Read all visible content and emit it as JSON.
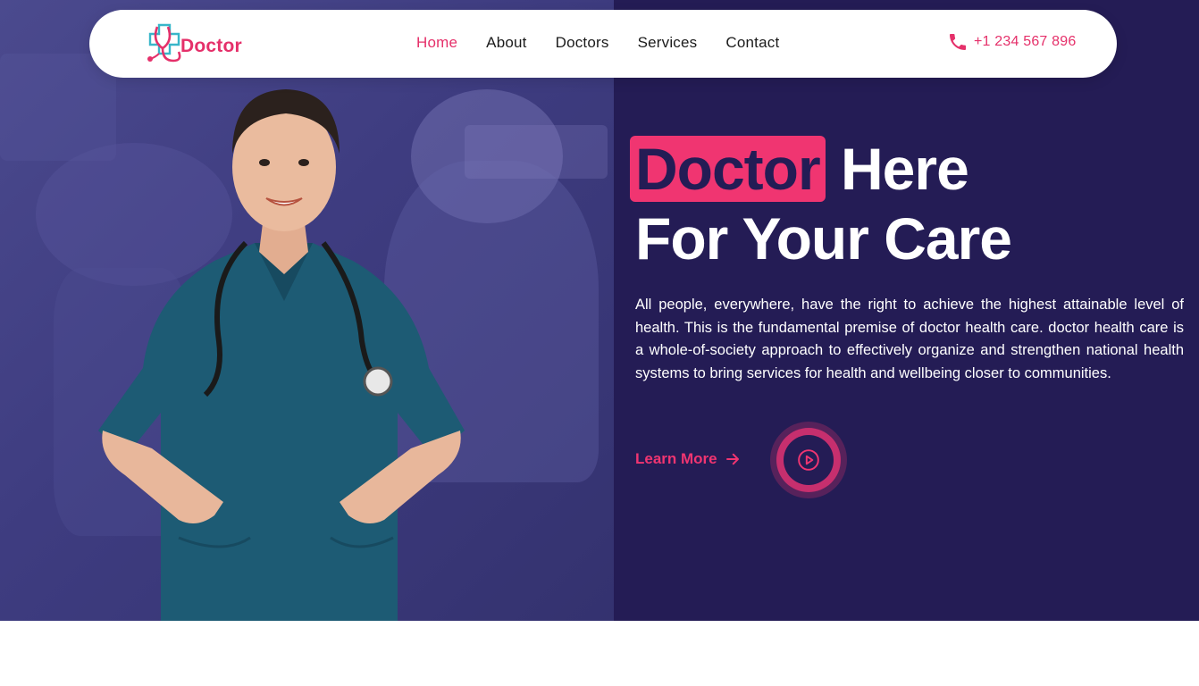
{
  "brand": {
    "name": "Doctor",
    "accent_color": "#e5306a",
    "logo_icon": "stethoscope-cross-icon"
  },
  "nav": {
    "items": [
      {
        "label": "Home",
        "active": true
      },
      {
        "label": "About",
        "active": false
      },
      {
        "label": "Doctors",
        "active": false
      },
      {
        "label": "Services",
        "active": false
      },
      {
        "label": "Contact",
        "active": false
      }
    ]
  },
  "contact": {
    "phone_icon": "phone-icon",
    "phone": "+1 234 567 896"
  },
  "hero": {
    "highlight_word": "Doctor",
    "title_rest_line1": "Here",
    "title_line2": "For Your Care",
    "description": "All people, everywhere, have the right to achieve the highest attainable level of health. This is the fundamental premise of doctor health care. doctor health care is a whole-of-society approach to effectively organize and strengthen national health systems to bring services for health and wellbeing closer to communities.",
    "cta_label": "Learn More",
    "cta_icon": "arrow-right-icon",
    "play_icon": "play-icon",
    "background_color": "#241c55",
    "image_alt_subject": "nurse-photo"
  }
}
